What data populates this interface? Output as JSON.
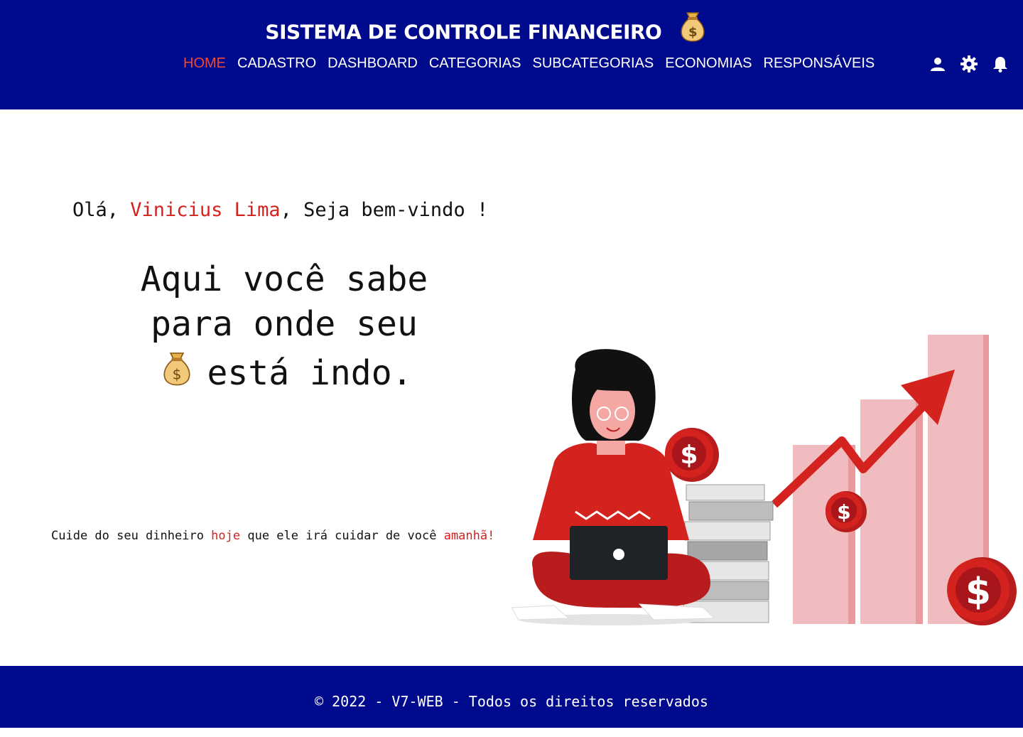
{
  "header": {
    "title": "SISTEMA DE CONTROLE FINANCEIRO",
    "nav": [
      {
        "label": "HOME",
        "active": true
      },
      {
        "label": "CADASTRO",
        "active": false
      },
      {
        "label": "DASHBOARD",
        "active": false
      },
      {
        "label": "CATEGORIAS",
        "active": false
      },
      {
        "label": "SUBCATEGORIAS",
        "active": false
      },
      {
        "label": "ECONOMIAS",
        "active": false
      },
      {
        "label": "RESPONSÁVEIS",
        "active": false
      }
    ],
    "icons": [
      "user-icon",
      "gear-icon",
      "bell-icon"
    ]
  },
  "main": {
    "greeting_prefix": "Olá, ",
    "user_name": "Vinicius Lima",
    "greeting_suffix": ", Seja bem-vindo !",
    "headline_line1": "Aqui você sabe",
    "headline_line2": "para onde seu",
    "headline_line3": "está indo.",
    "tagline_part1": "Cuide do seu dinheiro ",
    "tagline_highlight1": "hoje",
    "tagline_part2": " que ele irá cuidar de você ",
    "tagline_highlight2": "amanhã!"
  },
  "footer": {
    "text": "© 2022 - V7-WEB - Todos os direitos reservados"
  },
  "colors": {
    "navy": "#000a8c",
    "accent_red": "#d4231f",
    "nav_active": "#e84a3c"
  }
}
